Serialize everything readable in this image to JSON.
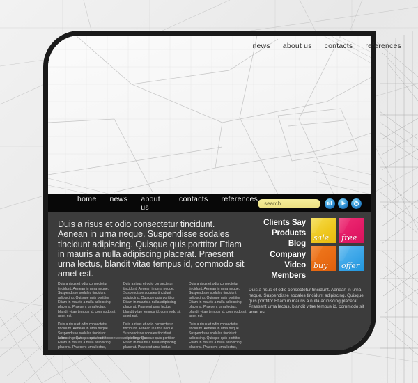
{
  "page": {
    "background_color": "#ededed",
    "frame_border_color": "#1a1a1a",
    "panel_color": "#3c3c3c",
    "menubar_color": "#080808"
  },
  "top_nav": {
    "items": [
      {
        "label": "news"
      },
      {
        "label": "about us"
      },
      {
        "label": "contacts"
      },
      {
        "label": "references"
      }
    ]
  },
  "main_nav": {
    "items": [
      {
        "label": "home"
      },
      {
        "label": "news"
      },
      {
        "label": "about us"
      },
      {
        "label": "contacts"
      },
      {
        "label": "references"
      }
    ]
  },
  "search": {
    "placeholder": "search",
    "value": "",
    "field_color": "#ece082"
  },
  "social": {
    "icons": [
      {
        "name": "flickr-icon"
      },
      {
        "name": "play-icon"
      },
      {
        "name": "refresh-icon"
      }
    ],
    "color": "#2f8fd4"
  },
  "headline": "Duis a risus et odio consectetur tincidunt. Aenean in urna neque. Suspendisse sodales tincidunt adipiscing. Quisque quis porttitor Etiam in mauris a nulla adipiscing placerat. Praesent urna lectus, blandit vitae tempus id, commodo sit amet est.",
  "body_paragraph": "Duis a risus et odio consectetur tincidunt. Aenean in urna neque. Suspendisse sodales tincidunt adipiscing. Quisque quis porttitor Etiam in mauris a nulla adipiscing placerat. Praesent urna lectus, blandit vitae tempus id, commodo sit amet est.",
  "columns": [
    {
      "paragraphs": [
        "Duis a risus et odio consectetur tincidunt. Aenean in urna neque. Suspendisse sodales tincidunt adipiscing. Quisque quis porttitor Etiam in mauris a nulla adipiscing placerat. Praesent urna lectus, blandit vitae tempus id, commodo sit amet est.",
        "Duis a risus et odio consectetur tincidunt. Aenean in urna neque. Suspendisse sodales tincidunt adipiscing. Quisque quis porttitor Etiam in mauris a nulla adipiscing placerat. Praesent urna lectus, blandit vitae tempus id, commodo sit amet est."
      ]
    },
    {
      "paragraphs": [
        "Duis a risus et odio consectetur tincidunt. Aenean in urna neque. Suspendisse sodales tincidunt adipiscing. Quisque quis porttitor Etiam in mauris a nulla adipiscing placerat. Praesent urna lectus, blandit vitae tempus id, commodo sit amet est.",
        "Duis a risus et odio consectetur tincidunt. Aenean in urna neque. Suspendisse sodales tincidunt adipiscing. Quisque quis porttitor Etiam in mauris a nulla adipiscing placerat. Praesent urna lectus, blandit vitae tempus id, commodo sit amet est."
      ]
    },
    {
      "paragraphs": [
        "Duis a risus et odio consectetur tincidunt. Aenean in urna neque. Suspendisse sodales tincidunt adipiscing. Quisque quis porttitor Etiam in mauris a nulla adipiscing placerat. Praesent urna lectus, blandit vitae tempus id, commodo sit amet est.",
        "Duis a risus et odio consectetur tincidunt. Aenean in urna neque. Suspendisse sodales tincidunt adipiscing. Quisque quis porttitor Etiam in mauris a nulla adipiscing placerat. Praesent urna lectus, blandit vitae tempus id, commodo sit amet est."
      ]
    }
  ],
  "right_menu": {
    "items": [
      {
        "label": "Clients Say"
      },
      {
        "label": "Products"
      },
      {
        "label": "Blog"
      },
      {
        "label": "Company"
      },
      {
        "label": "Video"
      },
      {
        "label": "Members"
      }
    ]
  },
  "tiles": [
    {
      "label": "sale",
      "color": "#efc81f"
    },
    {
      "label": "free",
      "color": "#e41b67"
    },
    {
      "label": "buy",
      "color": "#e96c14"
    },
    {
      "label": "offer",
      "color": "#3aa5e8"
    }
  ],
  "footer": {
    "items": [
      {
        "label": "home"
      },
      {
        "label": "news"
      },
      {
        "label": "about us"
      },
      {
        "label": "contacts"
      },
      {
        "label": "references"
      }
    ]
  }
}
